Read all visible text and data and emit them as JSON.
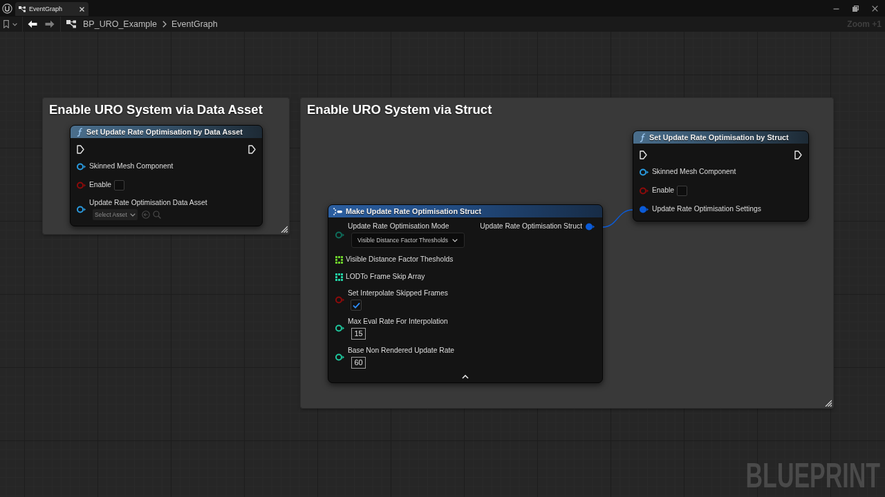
{
  "window": {
    "tab": {
      "label": "EventGraph"
    }
  },
  "toolbar": {
    "back": {
      "disabled": false
    },
    "forward": {
      "disabled": true
    },
    "breadcrumb": [
      {
        "label": "BP_URO_Example"
      },
      {
        "label": "EventGraph"
      }
    ]
  },
  "graph": {
    "zoom_label": "Zoom +1",
    "type_label": "BLUEPRINT",
    "comments": [
      {
        "title": "Enable URO System via Data Asset",
        "nodes": [
          {
            "kind": "function",
            "title": "Set Update Rate Optimisation by Data Asset",
            "inputs": [
              {
                "kind": "object",
                "label": "Skinned Mesh Component",
                "color": "#2a9be0",
                "connected": false
              },
              {
                "kind": "bool",
                "label": "Enable",
                "color": "#8e0b0b",
                "connected": false,
                "checked": false
              },
              {
                "kind": "asset",
                "label": "Update Rate Optimisation Data Asset",
                "color": "#2a9be0",
                "connected": false,
                "value": "Select Asset"
              }
            ]
          }
        ]
      },
      {
        "title": "Enable URO System via Struct",
        "nodes": [
          {
            "kind": "make_struct",
            "title": "Make Update Rate Optimisation Struct",
            "inputs": [
              {
                "kind": "enum",
                "label": "Update Rate Optimisation Mode",
                "color": "#0e6e5c",
                "connected": false,
                "value": "Visible Distance Factor Thresholds"
              },
              {
                "kind": "array",
                "label": "Visible Distance Factor Thesholds",
                "color": "#6cd12a",
                "connected": false
              },
              {
                "kind": "array",
                "label": "LODTo Frame Skip Array",
                "color": "#22d3a4",
                "connected": false
              },
              {
                "kind": "bool",
                "label": "Set Interpolate Skipped Frames",
                "color": "#8e0b0b",
                "connected": false,
                "checked": true
              },
              {
                "kind": "int",
                "label": "Max Eval Rate For Interpolation",
                "color": "#1fc99e",
                "connected": false,
                "value": "15"
              },
              {
                "kind": "int",
                "label": "Base Non Rendered Update Rate",
                "color": "#1fc99e",
                "connected": false,
                "value": "60"
              }
            ],
            "outputs": [
              {
                "kind": "struct",
                "label": "Update Rate Optimisation Struct",
                "color": "#0b5bd8",
                "connected": true
              }
            ],
            "advanced_expanded": true
          },
          {
            "kind": "function",
            "title": "Set Update Rate Optimisation by Struct",
            "inputs": [
              {
                "kind": "object",
                "label": "Skinned Mesh Component",
                "color": "#2a9be0",
                "connected": false
              },
              {
                "kind": "bool",
                "label": "Enable",
                "color": "#8e0b0b",
                "connected": false,
                "checked": false
              },
              {
                "kind": "struct",
                "label": "Update Rate Optimisation Settings",
                "color": "#0b5bd8",
                "connected": true
              }
            ]
          }
        ]
      }
    ]
  }
}
